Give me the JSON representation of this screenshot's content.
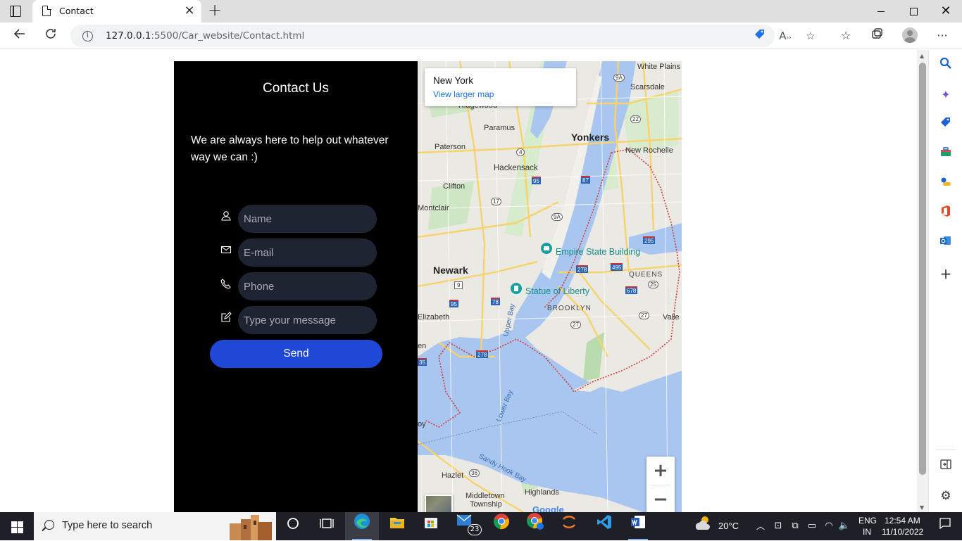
{
  "browser": {
    "tab_title": "Contact",
    "url_host": "127.0.0.1",
    "url_rest": ":5500/Car_website/Contact.html"
  },
  "contact": {
    "title": "Contact Us",
    "tagline": "We are always here to help out whatever way we can :)",
    "name_placeholder": "Name",
    "email_placeholder": "E-mail",
    "phone_placeholder": "Phone",
    "message_placeholder": "Type your message",
    "send_label": "Send"
  },
  "map": {
    "place_name": "New York",
    "larger_map_link": "View larger map",
    "labels": {
      "white_plains": "White Plains",
      "scarsdale": "Scarsdale",
      "ridgewood": "Ridgewood",
      "paramus": "Paramus",
      "yonkers": "Yonkers",
      "paterson": "Paterson",
      "new_rochelle": "New Rochelle",
      "hackensack": "Hackensack",
      "clifton": "Clifton",
      "montclair": "Montclair",
      "empire_state": "Empire State Building",
      "newark": "Newark",
      "queens": "QUEENS",
      "statue_liberty": "Statue of Liberty",
      "brooklyn": "BROOKLYN",
      "elizabeth": "Elizabeth",
      "valley": "Valle",
      "upper_bay": "Upper Bay",
      "lower_bay": "Lower Bay",
      "sandy_hook_bay": "Sandy Hook Bay",
      "hazlet": "Hazlet",
      "highlands": "Highlands",
      "middletown": "Middletown",
      "township": "Township",
      "linden": "en",
      "bay": "oy",
      "google": "Google"
    },
    "shields": [
      "9A",
      "22",
      "4",
      "95",
      "87",
      "17",
      "9A",
      "295",
      "278",
      "495",
      "9",
      "678",
      "25",
      "95",
      "78",
      "27",
      "27",
      "278",
      "35",
      "36"
    ]
  },
  "taskbar": {
    "search_placeholder": "Type here to search",
    "mail_badge": "23",
    "weather": "20°C",
    "lang_top": "ENG",
    "lang_bottom": "IN",
    "time": "12:54 AM",
    "date": "11/10/2022"
  },
  "colors": {
    "panel_bg": "#000000",
    "field_bg": "#1f2432",
    "send_bg": "#1f48d6",
    "link": "#1a73e8"
  }
}
